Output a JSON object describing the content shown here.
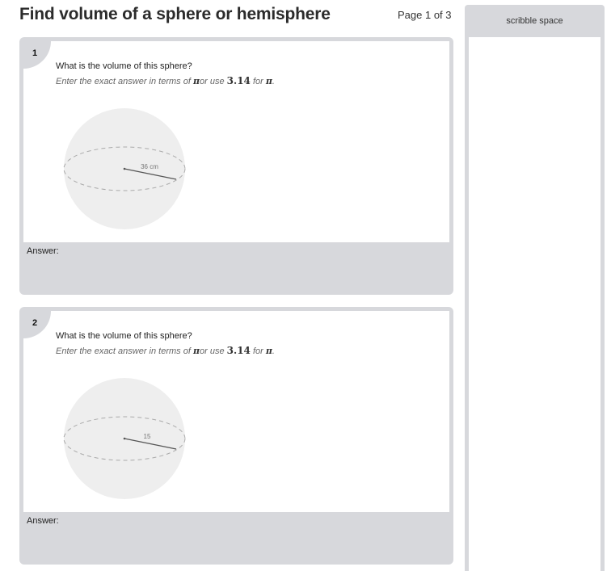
{
  "header": {
    "title": "Find volume of a sphere or hemisphere",
    "page": "Page 1 of 3"
  },
  "scribble": {
    "label": "scribble space"
  },
  "hint": {
    "prefix": "Enter the exact answer in terms of ",
    "pi": "π",
    "middle": "or use ",
    "value": "3.14",
    "suffix": " for ",
    "end": "."
  },
  "questions": [
    {
      "number": "1",
      "text": "What is the volume of this sphere?",
      "radius_label": "36 cm",
      "answer_label": "Answer:"
    },
    {
      "number": "2",
      "text": "What is the volume of this sphere?",
      "radius_label": "15",
      "answer_label": "Answer:"
    }
  ]
}
